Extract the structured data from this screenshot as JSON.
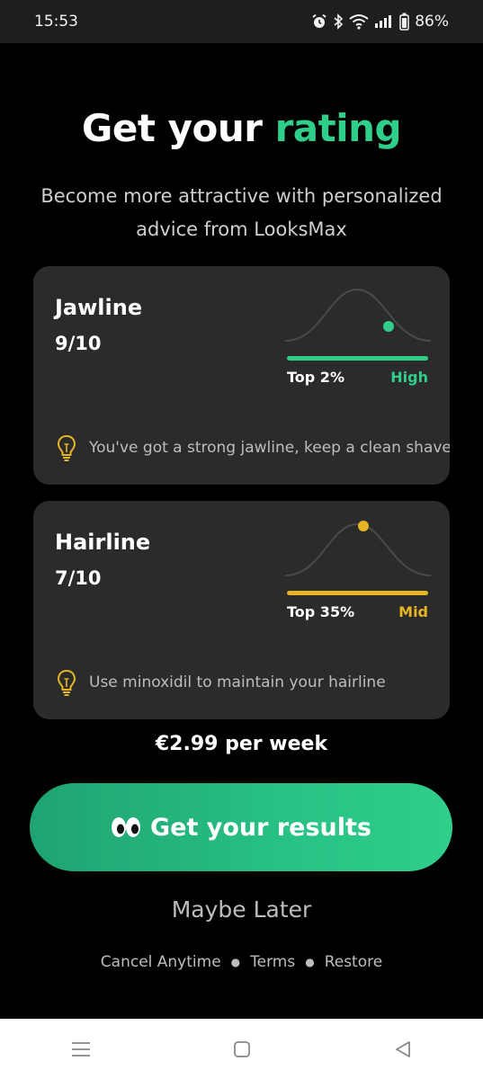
{
  "status": {
    "time": "15:53",
    "battery": "86%"
  },
  "header": {
    "title_part1": "Get your",
    "title_part2": "rating",
    "subtitle": "Become more attractive with personalized advice from LooksMax"
  },
  "cards": [
    {
      "title": "Jawline",
      "score": "9/10",
      "rank": "Top 2%",
      "level": "High",
      "level_color": "#2fcf8a",
      "tip": "You've got a strong jawline, keep a clean shave"
    },
    {
      "title": "Hairline",
      "score": "7/10",
      "rank": "Top 35%",
      "level": "Mid",
      "level_color": "#e5b523",
      "tip": "Use minoxidil to maintain your hairline"
    }
  ],
  "pricing": {
    "text": "€2.99 per week"
  },
  "cta": {
    "icon": "eyes-emoji-icon",
    "label": "Get your results"
  },
  "secondary": {
    "maybe_later": "Maybe Later"
  },
  "footer": {
    "links": [
      "Cancel Anytime",
      "Terms",
      "Restore"
    ]
  },
  "colors": {
    "accent": "#2fcf8a",
    "mid": "#e5b523",
    "card_bg": "#2b2b2b"
  }
}
